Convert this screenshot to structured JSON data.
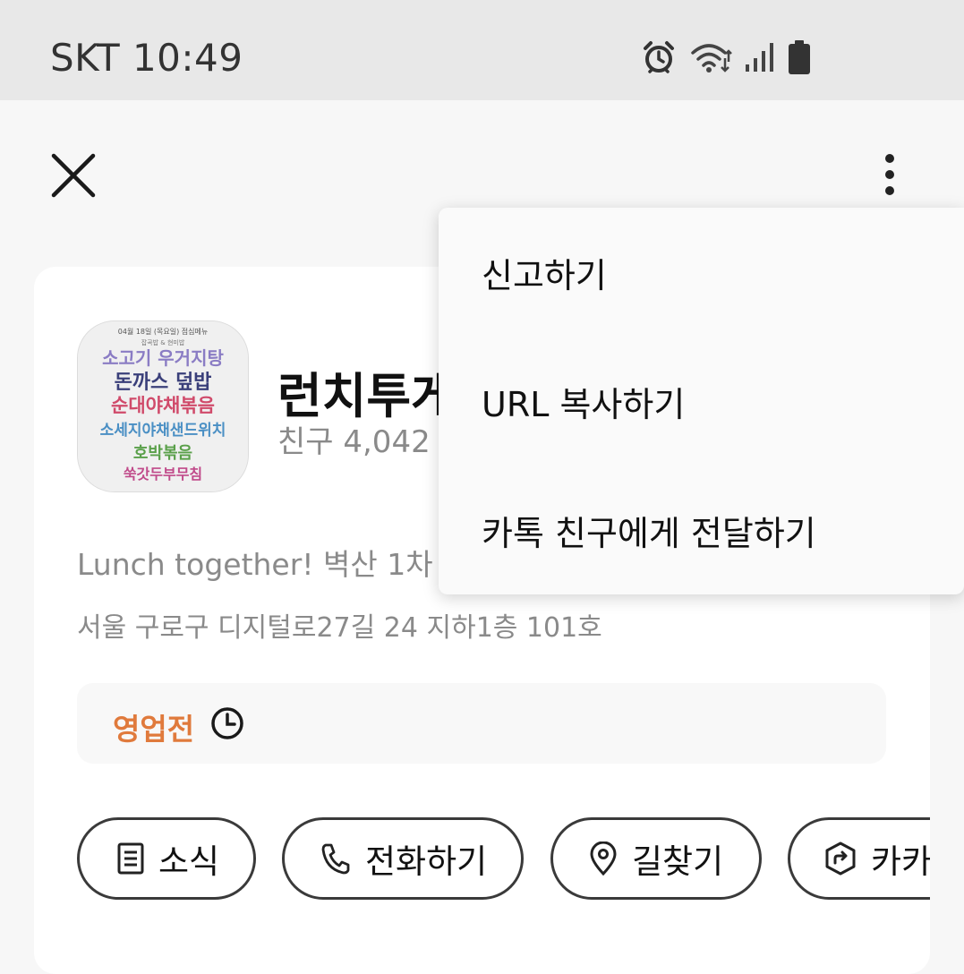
{
  "status_bar": {
    "carrier_time": "SKT 10:49",
    "icons": [
      "alarm-icon",
      "wifi-icon",
      "signal-icon",
      "battery-icon"
    ]
  },
  "toolbar": {
    "close_icon": "close-icon",
    "more_icon": "more-vertical-icon"
  },
  "profile": {
    "name": "런치투게",
    "friends": "친구 4,042",
    "description": "Lunch together!  벽산 1차 ",
    "address": "서울 구로구 디지털로27길 24 지하1층 101호",
    "hours_status": "영업전",
    "hours_icon": "clock-icon",
    "menu_image": {
      "header": "04월 18일 (목요일) 점심메뉴",
      "subheader": "잡곡밥 & 현미밥",
      "lines": [
        "소고기 우거지탕",
        "돈까스 덮밥",
        "순대야채볶음",
        "소세지야채샌드위치",
        "호박볶음",
        "쑥갓두부무침"
      ]
    }
  },
  "actions": [
    {
      "label": "소식",
      "icon": "news-icon"
    },
    {
      "label": "전화하기",
      "icon": "phone-icon"
    },
    {
      "label": "길찾기",
      "icon": "location-pin-icon"
    },
    {
      "label": "카카",
      "icon": "share-icon"
    }
  ],
  "overflow_menu": {
    "items": [
      "신고하기",
      "URL 복사하기",
      "카톡 친구에게 전달하기"
    ]
  },
  "colors": {
    "hours_status": "#e07a3c",
    "menu_line_1": "#8a7cc4",
    "menu_line_2": "#3a3f7a",
    "menu_line_3": "#d04a6a",
    "menu_line_4": "#4a8fc4",
    "menu_line_5": "#5aa04a",
    "menu_line_6": "#c04a8a"
  }
}
